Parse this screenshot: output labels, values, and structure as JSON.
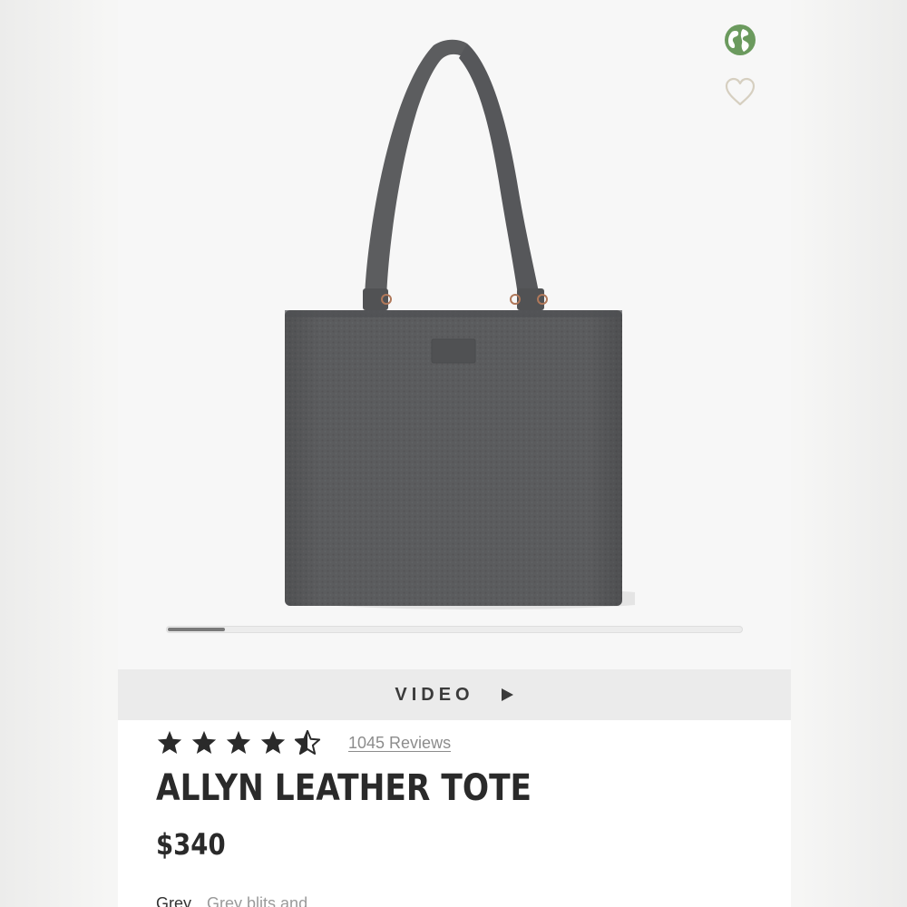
{
  "gallery": {
    "progress_fraction": 0.1,
    "product_image_alt": "Allyn Leather Tote in storm grey"
  },
  "video": {
    "label": "VIDEO"
  },
  "product": {
    "rating": 4.5,
    "max_rating": 5,
    "reviews_label": "1045 Reviews",
    "title": "ALLYN LEATHER TOTE",
    "price": "$340",
    "color_label": "Grey",
    "color_value": "Grey blits and ...",
    "colors": {
      "globe_green": "#6b9a5e",
      "heart_outline": "#d6cfc0",
      "bag_leather": "#5a5b5d",
      "text_dark": "#2a2a2a"
    }
  }
}
